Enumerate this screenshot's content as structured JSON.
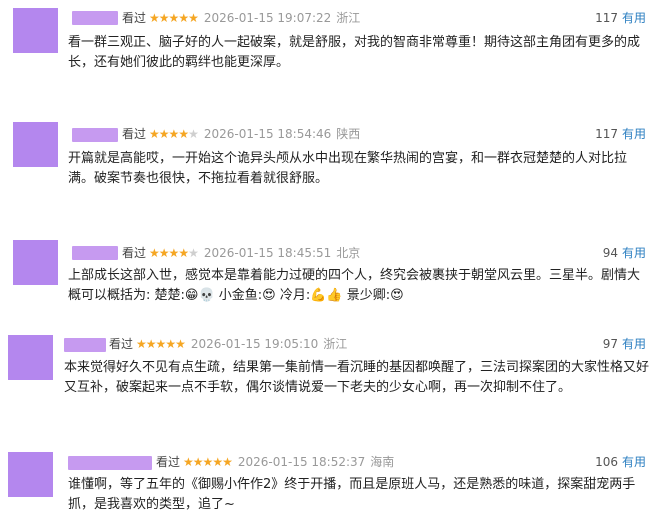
{
  "reviews": [
    {
      "watched": "看过",
      "rating": 5,
      "time": "2026-01-15 19:07:22",
      "location": "浙江",
      "useful_count": "117",
      "useful_label": "有用",
      "content": "看一群三观正、脑子好的人一起破案，就是舒服，对我的智商非常尊重！期待这部主角团有更多的成长，还有她们彼此的羁绊也能更深厚。"
    },
    {
      "watched": "看过",
      "rating": 4,
      "time": "2026-01-15 18:54:46",
      "location": "陕西",
      "useful_count": "117",
      "useful_label": "有用",
      "content": "开篇就是高能哎，一开始这个诡异头颅从水中出现在繁华热闹的宫宴，和一群衣冠楚楚的人对比拉满。破案节奏也很快，不拖拉看着就很舒服。"
    },
    {
      "watched": "看过",
      "rating": 4,
      "time": "2026-01-15 18:45:51",
      "location": "北京",
      "useful_count": "94",
      "useful_label": "有用",
      "content": "上部成长这部入世，感觉本是靠着能力过硬的四个人，终究会被裹挟于朝堂风云里。三星半。剧情大概可以概括为: 楚楚:😁💀 小金鱼:😍 冷月:💪👍 景少卿:😍"
    },
    {
      "watched": "看过",
      "rating": 5,
      "time": "2026-01-15 19:05:10",
      "location": "浙江",
      "useful_count": "97",
      "useful_label": "有用",
      "content": "本来觉得好久不见有点生疏，结果第一集前情一看沉睡的基因都唤醒了，三法司探案团的大家性格又好又互补，破案起来一点不手软，偶尔谈情说爱一下老夫的少女心啊，再一次抑制不住了。"
    },
    {
      "watched": "看过",
      "rating": 5,
      "time": "2026-01-15 18:52:37",
      "location": "海南",
      "useful_count": "106",
      "useful_label": "有用",
      "content": "谁懂啊，等了五年的《御赐小仵作2》终于开播，而且是原班人马，还是熟悉的味道，探案甜宠两手抓，是我喜欢的类型，追了~"
    }
  ],
  "colors": {
    "avatar": "#b487ee",
    "star_on": "#f5a623",
    "star_off": "#cfcfcf",
    "useful_link": "#2c7fc1"
  }
}
